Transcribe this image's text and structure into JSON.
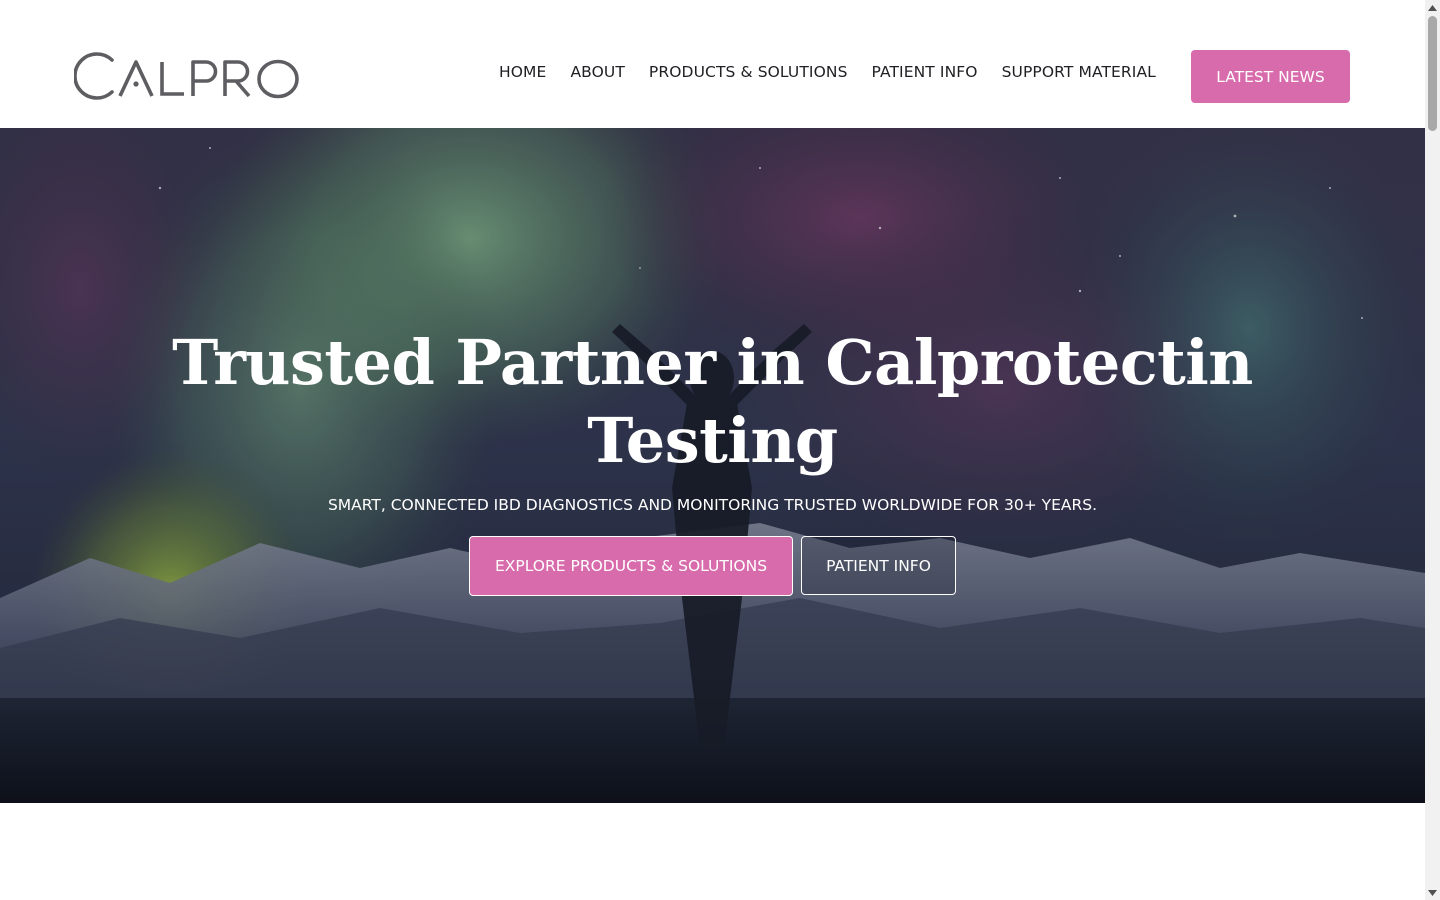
{
  "header": {
    "logo_text": "CALPRO",
    "nav": [
      {
        "label": "HOME"
      },
      {
        "label": "ABOUT"
      },
      {
        "label": "PRODUCTS & SOLUTIONS"
      },
      {
        "label": "PATIENT INFO"
      },
      {
        "label": "SUPPORT MATERIAL"
      }
    ],
    "news_button": "LATEST NEWS"
  },
  "hero": {
    "title_line1": "Trusted Partner in Calprotectin",
    "title_line2": "Testing",
    "subtitle": "SMART, CONNECTED IBD DIAGNOSTICS AND MONITORING TRUSTED WORLDWIDE FOR 30+ YEARS.",
    "primary_cta": "EXPLORE PRODUCTS & SOLUTIONS",
    "secondary_cta": "PATIENT INFO"
  },
  "colors": {
    "accent": "#d86bab",
    "nav_text": "#1f1f24",
    "logo_gray": "#5e5e62",
    "logo_dot": "#d86bab"
  },
  "icons": {
    "scroll_up": "triangle-up-icon",
    "scroll_down": "triangle-down-icon"
  }
}
